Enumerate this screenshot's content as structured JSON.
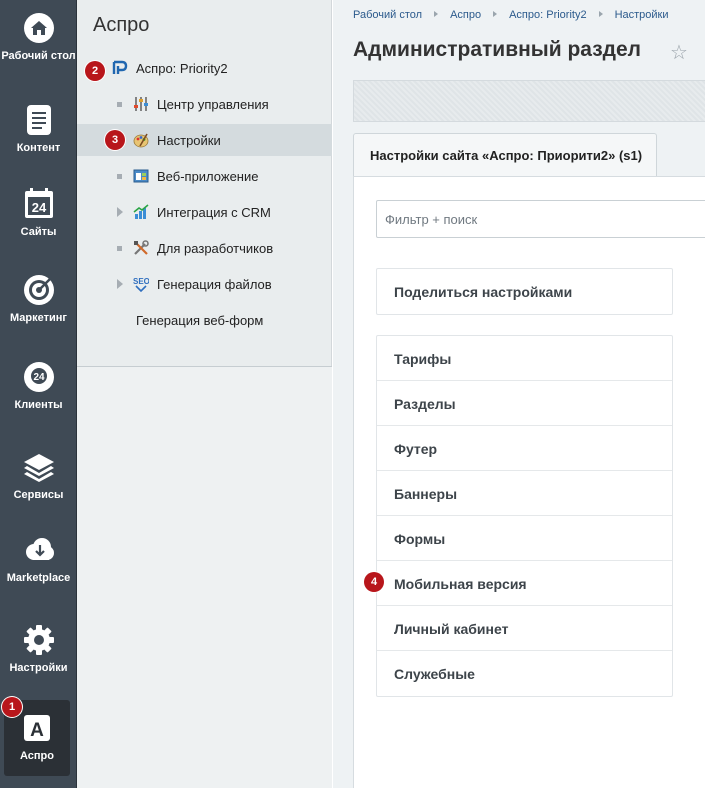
{
  "rail": {
    "items": [
      {
        "label": "Рабочий стол",
        "icon": "home-icon"
      },
      {
        "label": "Контент",
        "icon": "document-icon"
      },
      {
        "label": "Сайты",
        "icon": "calendar-24-icon"
      },
      {
        "label": "Маркетинг",
        "icon": "target-icon"
      },
      {
        "label": "Клиенты",
        "icon": "clients-24-icon"
      },
      {
        "label": "Сервисы",
        "icon": "layers-icon"
      },
      {
        "label": "Marketplace",
        "icon": "cloud-download-icon"
      },
      {
        "label": "Настройки",
        "icon": "gear-icon"
      },
      {
        "label": "Аспро",
        "icon": "aspro-a-icon"
      }
    ],
    "badge": "1"
  },
  "menu": {
    "title": "Аспро",
    "root": {
      "label": "Аспро: Priority2",
      "badge": "2"
    },
    "items": [
      {
        "label": "Центр управления"
      },
      {
        "label": "Настройки",
        "badge": "3"
      },
      {
        "label": "Веб-приложение"
      },
      {
        "label": "Интеграция с CRM"
      },
      {
        "label": "Для разработчиков"
      },
      {
        "label": "Генерация файлов"
      },
      {
        "label": "Генерация веб-форм"
      }
    ]
  },
  "breadcrumb": [
    "Рабочий стол",
    "Аспро",
    "Аспро: Priority2",
    "Настройки"
  ],
  "page": {
    "title": "Административный раздел",
    "tab": "Настройки сайта «Аспро: Приорити2» (s1)",
    "filter_placeholder": "Фильтр + поиск"
  },
  "share": {
    "label": "Поделиться настройками"
  },
  "sections": [
    {
      "label": "Тарифы"
    },
    {
      "label": "Разделы"
    },
    {
      "label": "Футер"
    },
    {
      "label": "Баннеры"
    },
    {
      "label": "Формы"
    },
    {
      "label": "Мобильная версия",
      "badge": "4"
    },
    {
      "label": "Личный кабинет"
    },
    {
      "label": "Служебные"
    }
  ],
  "colors": {
    "rail": "#3f4a55",
    "menu": "#e9edee",
    "badge": "#b8161b",
    "link": "#2b5a8c"
  }
}
